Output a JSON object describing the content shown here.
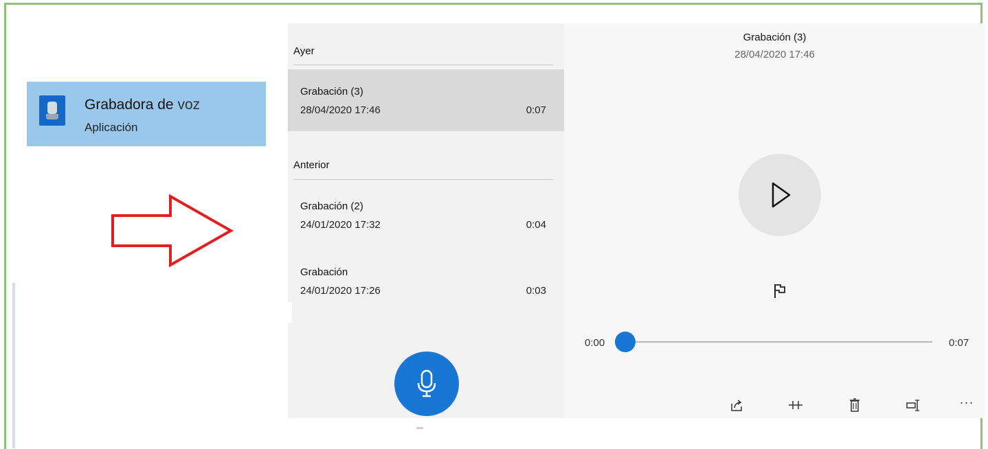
{
  "search_result": {
    "title_part1": "Grabadora de",
    "title_part2": "voz",
    "subtitle": "Aplicación",
    "icon": "voice-recorder-icon"
  },
  "recordings_list": {
    "sections": [
      {
        "header": "Ayer",
        "items": [
          {
            "name": "Grabación (3)",
            "date": "28/04/2020 17:46",
            "duration": "0:07",
            "selected": true
          }
        ]
      },
      {
        "header": "Anterior",
        "items": [
          {
            "name": "Grabación (2)",
            "date": "24/01/2020 17:32",
            "duration": "0:04",
            "selected": false
          },
          {
            "name": "Grabación",
            "date": "24/01/2020 17:26",
            "duration": "0:03",
            "selected": false
          }
        ]
      }
    ],
    "record_button_icon": "microphone-icon"
  },
  "player": {
    "title": "Grabación (3)",
    "date": "28/04/2020 17:46",
    "time_current": "0:00",
    "time_total": "0:07",
    "progress": 0,
    "toolbar_icons": [
      "share-icon",
      "trim-icon",
      "delete-icon",
      "rename-icon",
      "more-icon"
    ],
    "more_label": "..."
  },
  "colors": {
    "accent": "#1877d4",
    "selection_tile": "#99c8ec",
    "arrow": "#e02020",
    "frame": "#8fc07a"
  }
}
